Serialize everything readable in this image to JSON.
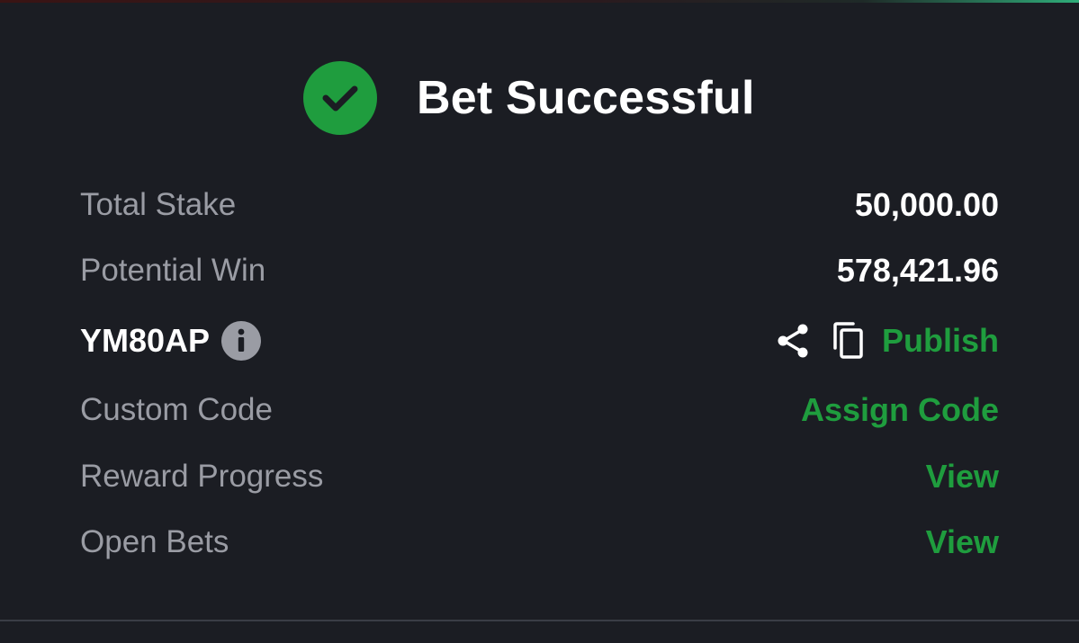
{
  "header": {
    "title": "Bet Successful",
    "icon": "check-circle-icon"
  },
  "details": {
    "total_stake": {
      "label": "Total Stake",
      "value": "50,000.00"
    },
    "potential_win": {
      "label": "Potential Win",
      "value": "578,421.96"
    },
    "booking_code": {
      "code": "YM80AP",
      "info_icon": "info-icon",
      "share_icon": "share-icon",
      "copy_icon": "copy-icon",
      "publish_label": "Publish"
    },
    "custom_code": {
      "label": "Custom Code",
      "action": "Assign Code"
    },
    "reward_progress": {
      "label": "Reward Progress",
      "action": "View"
    },
    "open_bets": {
      "label": "Open Bets",
      "action": "View"
    }
  },
  "colors": {
    "background": "#1b1d23",
    "accent_green": "#1f9d3e",
    "label_gray": "#9a9ca4",
    "text_white": "#ffffff"
  }
}
